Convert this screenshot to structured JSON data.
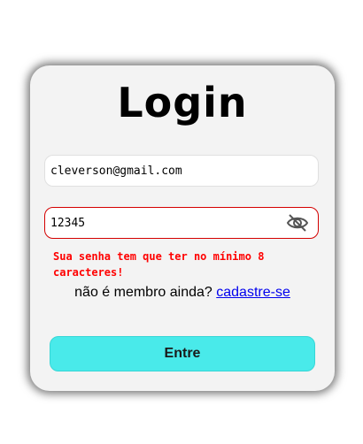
{
  "login": {
    "title": "Login",
    "email_value": "cleverson@gmail.com",
    "password_value": "12345",
    "password_toggle_icon": "eye-off-icon",
    "error_message": "Sua senha tem que ter no mínimo 8 caracteres!",
    "signup_prompt": "não é membro ainda?",
    "signup_link": "cadastre-se",
    "submit_label": "Entre"
  },
  "colors": {
    "error": "#ff0000",
    "submit_bg": "#49eaea",
    "link": "#0000ee",
    "card_bg": "#f3f3f3"
  }
}
